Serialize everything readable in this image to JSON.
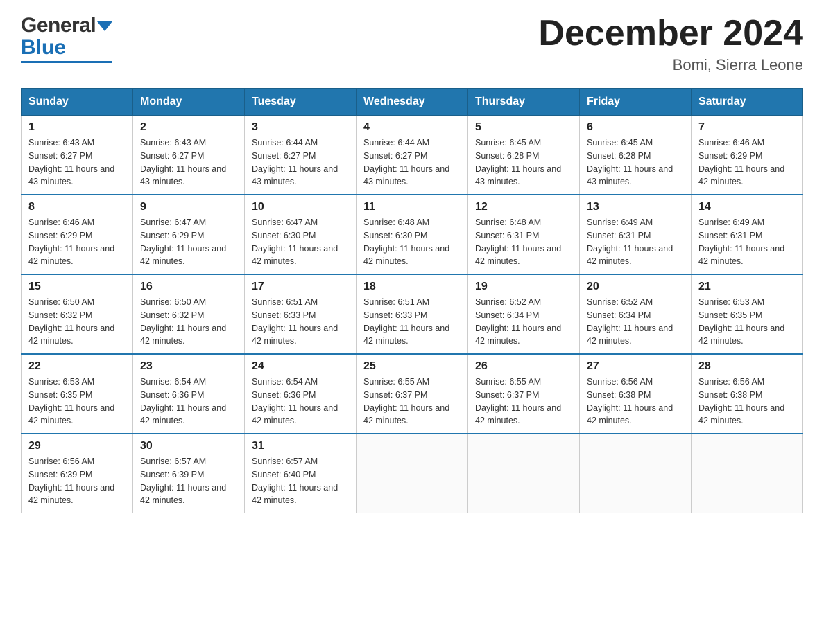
{
  "header": {
    "logo_general": "General",
    "logo_blue": "Blue",
    "title": "December 2024",
    "location": "Bomi, Sierra Leone"
  },
  "calendar": {
    "days_of_week": [
      "Sunday",
      "Monday",
      "Tuesday",
      "Wednesday",
      "Thursday",
      "Friday",
      "Saturday"
    ],
    "weeks": [
      [
        {
          "day": "1",
          "sunrise": "6:43 AM",
          "sunset": "6:27 PM",
          "daylight": "11 hours and 43 minutes."
        },
        {
          "day": "2",
          "sunrise": "6:43 AM",
          "sunset": "6:27 PM",
          "daylight": "11 hours and 43 minutes."
        },
        {
          "day": "3",
          "sunrise": "6:44 AM",
          "sunset": "6:27 PM",
          "daylight": "11 hours and 43 minutes."
        },
        {
          "day": "4",
          "sunrise": "6:44 AM",
          "sunset": "6:27 PM",
          "daylight": "11 hours and 43 minutes."
        },
        {
          "day": "5",
          "sunrise": "6:45 AM",
          "sunset": "6:28 PM",
          "daylight": "11 hours and 43 minutes."
        },
        {
          "day": "6",
          "sunrise": "6:45 AM",
          "sunset": "6:28 PM",
          "daylight": "11 hours and 43 minutes."
        },
        {
          "day": "7",
          "sunrise": "6:46 AM",
          "sunset": "6:29 PM",
          "daylight": "11 hours and 42 minutes."
        }
      ],
      [
        {
          "day": "8",
          "sunrise": "6:46 AM",
          "sunset": "6:29 PM",
          "daylight": "11 hours and 42 minutes."
        },
        {
          "day": "9",
          "sunrise": "6:47 AM",
          "sunset": "6:29 PM",
          "daylight": "11 hours and 42 minutes."
        },
        {
          "day": "10",
          "sunrise": "6:47 AM",
          "sunset": "6:30 PM",
          "daylight": "11 hours and 42 minutes."
        },
        {
          "day": "11",
          "sunrise": "6:48 AM",
          "sunset": "6:30 PM",
          "daylight": "11 hours and 42 minutes."
        },
        {
          "day": "12",
          "sunrise": "6:48 AM",
          "sunset": "6:31 PM",
          "daylight": "11 hours and 42 minutes."
        },
        {
          "day": "13",
          "sunrise": "6:49 AM",
          "sunset": "6:31 PM",
          "daylight": "11 hours and 42 minutes."
        },
        {
          "day": "14",
          "sunrise": "6:49 AM",
          "sunset": "6:31 PM",
          "daylight": "11 hours and 42 minutes."
        }
      ],
      [
        {
          "day": "15",
          "sunrise": "6:50 AM",
          "sunset": "6:32 PM",
          "daylight": "11 hours and 42 minutes."
        },
        {
          "day": "16",
          "sunrise": "6:50 AM",
          "sunset": "6:32 PM",
          "daylight": "11 hours and 42 minutes."
        },
        {
          "day": "17",
          "sunrise": "6:51 AM",
          "sunset": "6:33 PM",
          "daylight": "11 hours and 42 minutes."
        },
        {
          "day": "18",
          "sunrise": "6:51 AM",
          "sunset": "6:33 PM",
          "daylight": "11 hours and 42 minutes."
        },
        {
          "day": "19",
          "sunrise": "6:52 AM",
          "sunset": "6:34 PM",
          "daylight": "11 hours and 42 minutes."
        },
        {
          "day": "20",
          "sunrise": "6:52 AM",
          "sunset": "6:34 PM",
          "daylight": "11 hours and 42 minutes."
        },
        {
          "day": "21",
          "sunrise": "6:53 AM",
          "sunset": "6:35 PM",
          "daylight": "11 hours and 42 minutes."
        }
      ],
      [
        {
          "day": "22",
          "sunrise": "6:53 AM",
          "sunset": "6:35 PM",
          "daylight": "11 hours and 42 minutes."
        },
        {
          "day": "23",
          "sunrise": "6:54 AM",
          "sunset": "6:36 PM",
          "daylight": "11 hours and 42 minutes."
        },
        {
          "day": "24",
          "sunrise": "6:54 AM",
          "sunset": "6:36 PM",
          "daylight": "11 hours and 42 minutes."
        },
        {
          "day": "25",
          "sunrise": "6:55 AM",
          "sunset": "6:37 PM",
          "daylight": "11 hours and 42 minutes."
        },
        {
          "day": "26",
          "sunrise": "6:55 AM",
          "sunset": "6:37 PM",
          "daylight": "11 hours and 42 minutes."
        },
        {
          "day": "27",
          "sunrise": "6:56 AM",
          "sunset": "6:38 PM",
          "daylight": "11 hours and 42 minutes."
        },
        {
          "day": "28",
          "sunrise": "6:56 AM",
          "sunset": "6:38 PM",
          "daylight": "11 hours and 42 minutes."
        }
      ],
      [
        {
          "day": "29",
          "sunrise": "6:56 AM",
          "sunset": "6:39 PM",
          "daylight": "11 hours and 42 minutes."
        },
        {
          "day": "30",
          "sunrise": "6:57 AM",
          "sunset": "6:39 PM",
          "daylight": "11 hours and 42 minutes."
        },
        {
          "day": "31",
          "sunrise": "6:57 AM",
          "sunset": "6:40 PM",
          "daylight": "11 hours and 42 minutes."
        },
        null,
        null,
        null,
        null
      ]
    ]
  }
}
